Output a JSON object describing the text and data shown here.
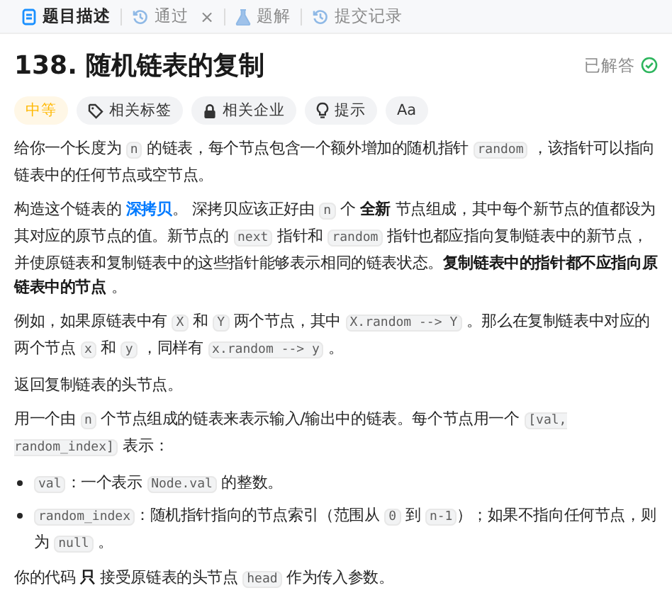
{
  "tabs": [
    {
      "label": "题目描述",
      "kind": "description",
      "selected": true
    },
    {
      "label": "通过",
      "kind": "accepted",
      "selected": false,
      "close": "×"
    },
    {
      "label": "题解",
      "kind": "solutions",
      "selected": false
    },
    {
      "label": "提交记录",
      "kind": "submissions",
      "selected": false
    }
  ],
  "problem": {
    "title": "138. 随机链表的复制",
    "status": "已解答",
    "solved": true
  },
  "tags": [
    {
      "kind": "difficulty",
      "label": "中等"
    },
    {
      "kind": "topics",
      "label": "相关标签"
    },
    {
      "kind": "companies",
      "label": "相关企业"
    },
    {
      "kind": "hint",
      "label": "提示"
    },
    {
      "kind": "font",
      "label": "Aa"
    }
  ],
  "content": [
    {
      "kind": "paragraph",
      "segments": [
        {
          "kind": "text",
          "text": "给你一个长度为 "
        },
        {
          "kind": "code",
          "text": "n"
        },
        {
          "kind": "text",
          "text": " 的链表，每个节点包含一个额外增加的随机指针 "
        },
        {
          "kind": "code",
          "text": "random"
        },
        {
          "kind": "text",
          "text": " ，该指针可以指向链表中的任何节点或空节点。"
        }
      ]
    },
    {
      "kind": "paragraph",
      "segments": [
        {
          "kind": "text",
          "text": "构造这个链表的 "
        },
        {
          "kind": "link",
          "text": "深拷贝"
        },
        {
          "kind": "text",
          "text": "。 深拷贝应该正好由 "
        },
        {
          "kind": "code",
          "text": "n"
        },
        {
          "kind": "text",
          "text": " 个 "
        },
        {
          "kind": "bold",
          "text": "全新"
        },
        {
          "kind": "text",
          "text": " 节点组成，其中每个新节点的值都设为其对应的原节点的值。新节点的 "
        },
        {
          "kind": "code",
          "text": "next"
        },
        {
          "kind": "text",
          "text": " 指针和 "
        },
        {
          "kind": "code",
          "text": "random"
        },
        {
          "kind": "text",
          "text": " 指针也都应指向复制链表中的新节点，并使原链表和复制链表中的这些指针能够表示相同的链表状态。"
        },
        {
          "kind": "bold",
          "text": "复制链表中的指针都不应指向原链表中的节点 "
        },
        {
          "kind": "text",
          "text": "。"
        }
      ]
    },
    {
      "kind": "paragraph",
      "segments": [
        {
          "kind": "text",
          "text": "例如，如果原链表中有 "
        },
        {
          "kind": "code",
          "text": "X"
        },
        {
          "kind": "text",
          "text": " 和 "
        },
        {
          "kind": "code",
          "text": "Y"
        },
        {
          "kind": "text",
          "text": " 两个节点，其中 "
        },
        {
          "kind": "code",
          "text": "X.random --> Y"
        },
        {
          "kind": "text",
          "text": " 。那么在复制链表中对应的两个节点 "
        },
        {
          "kind": "code",
          "text": "x"
        },
        {
          "kind": "text",
          "text": " 和 "
        },
        {
          "kind": "code",
          "text": "y"
        },
        {
          "kind": "text",
          "text": " ，同样有 "
        },
        {
          "kind": "code",
          "text": "x.random --> y"
        },
        {
          "kind": "text",
          "text": " 。"
        }
      ]
    },
    {
      "kind": "paragraph",
      "segments": [
        {
          "kind": "text",
          "text": "返回复制链表的头节点。"
        }
      ]
    },
    {
      "kind": "paragraph",
      "segments": [
        {
          "kind": "text",
          "text": "用一个由 "
        },
        {
          "kind": "code",
          "text": "n"
        },
        {
          "kind": "text",
          "text": " 个节点组成的链表来表示输入/输出中的链表。每个节点用一个 "
        },
        {
          "kind": "code",
          "text": "[val, random_index]"
        },
        {
          "kind": "text",
          "text": " 表示："
        }
      ]
    },
    {
      "kind": "bullets",
      "items": [
        {
          "segments": [
            {
              "kind": "code",
              "text": "val"
            },
            {
              "kind": "text",
              "text": "：一个表示 "
            },
            {
              "kind": "code",
              "text": "Node.val"
            },
            {
              "kind": "text",
              "text": " 的整数。"
            }
          ]
        },
        {
          "segments": [
            {
              "kind": "code",
              "text": "random_index"
            },
            {
              "kind": "text",
              "text": "：随机指针指向的节点索引（范围从 "
            },
            {
              "kind": "code",
              "text": "0"
            },
            {
              "kind": "text",
              "text": " 到 "
            },
            {
              "kind": "code",
              "text": "n-1"
            },
            {
              "kind": "text",
              "text": "）；如果不指向任何节点，则为 "
            },
            {
              "kind": "code",
              "text": "null"
            },
            {
              "kind": "text",
              "text": " 。"
            }
          ]
        }
      ]
    },
    {
      "kind": "paragraph",
      "segments": [
        {
          "kind": "text",
          "text": "你的代码 "
        },
        {
          "kind": "bold",
          "text": "只"
        },
        {
          "kind": "text",
          "text": " 接受原链表的头节点 "
        },
        {
          "kind": "code",
          "text": "head"
        },
        {
          "kind": "text",
          "text": " 作为传入参数。"
        }
      ]
    }
  ]
}
